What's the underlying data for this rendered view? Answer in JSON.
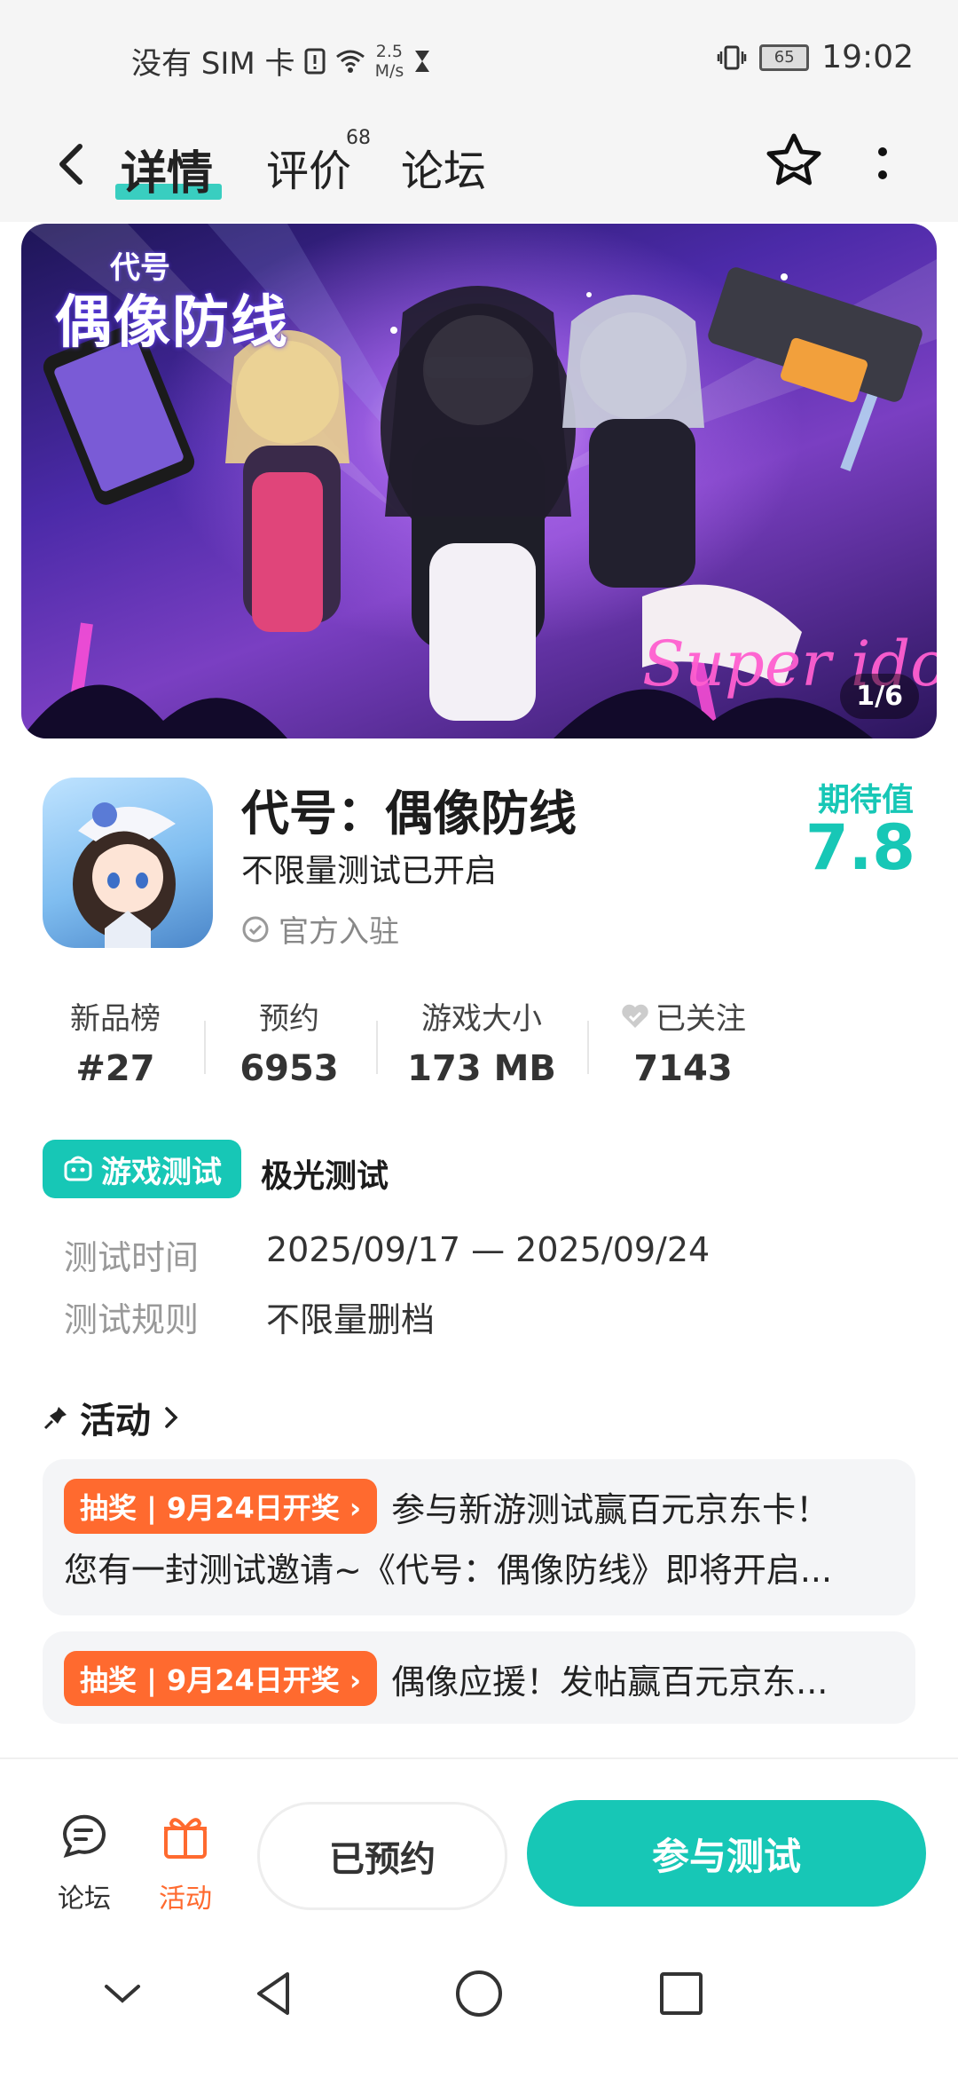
{
  "status": {
    "carrier": "没有 SIM 卡",
    "speed_value": "2.5",
    "speed_unit": "M/s",
    "battery": "65",
    "time": "19:02"
  },
  "nav": {
    "tabs": [
      {
        "label": "详情",
        "active": true
      },
      {
        "label": "评价",
        "badge": "68"
      },
      {
        "label": "论坛"
      }
    ]
  },
  "banner": {
    "logo_sub": "代号",
    "logo_title": "偶像防线",
    "counter": "1/6"
  },
  "game": {
    "title": "代号：偶像防线",
    "subtitle": "不限量测试已开启",
    "official": "官方入驻",
    "expect_label": "期待值",
    "expect_value": "7.8"
  },
  "stats": [
    {
      "label": "新品榜",
      "value": "#27"
    },
    {
      "label": "预约",
      "value": "6953"
    },
    {
      "label": "游戏大小",
      "value": "173 MB"
    },
    {
      "label": "已关注",
      "value": "7143"
    }
  ],
  "test": {
    "badge": "游戏测试",
    "name": "极光测试",
    "rows": [
      {
        "label": "测试时间",
        "value": "2025/09/17 — 2025/09/24"
      },
      {
        "label": "测试规则",
        "value": "不限量删档"
      }
    ]
  },
  "activity": {
    "header": "活动",
    "cards": [
      {
        "pill": "抽奖 | 9月24日开奖",
        "head": "参与新游测试赢百元京东卡！",
        "body": "您有一封测试邀请~《代号：偶像防线》即将开启..."
      },
      {
        "pill": "抽奖 | 9月24日开奖",
        "head": "偶像应援！发帖赢百元京东..."
      }
    ]
  },
  "bottom": {
    "forum": "论坛",
    "activity": "活动",
    "reserved": "已预约",
    "join": "参与测试"
  },
  "colors": {
    "accent": "#17c7b6",
    "orange": "#ff6a2f"
  }
}
